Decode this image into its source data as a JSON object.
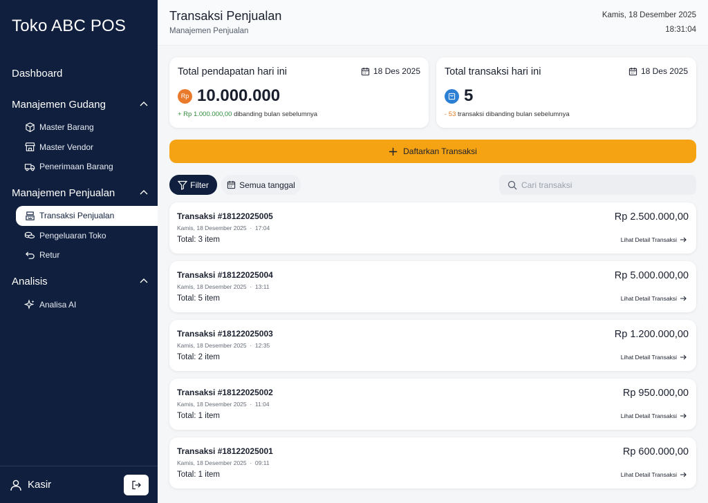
{
  "sidebar": {
    "brand": "Toko ABC POS",
    "dashboard": "Dashboard",
    "sections": [
      {
        "label": "Manajemen Gudang",
        "items": [
          {
            "label": "Master Barang",
            "icon": "box-icon"
          },
          {
            "label": "Master Vendor",
            "icon": "store-icon"
          },
          {
            "label": "Penerimaan Barang",
            "icon": "truck-icon"
          }
        ]
      },
      {
        "label": "Manajemen Penjualan",
        "items": [
          {
            "label": "Transaksi Penjualan",
            "icon": "register-icon",
            "active": true
          },
          {
            "label": "Pengeluaran Toko",
            "icon": "coins-icon"
          },
          {
            "label": "Retur",
            "icon": "undo-icon"
          }
        ]
      },
      {
        "label": "Analisis",
        "items": [
          {
            "label": "Analisa AI",
            "icon": "sparkle-icon"
          }
        ]
      }
    ],
    "user": "Kasir"
  },
  "header": {
    "title": "Transaksi Penjualan",
    "subtitle": "Manajemen Penjualan",
    "date": "Kamis, 18 Desember 2025",
    "time": "18:31:04"
  },
  "stats": {
    "revenue": {
      "title": "Total pendapatan hari ini",
      "date": "18 Des 2025",
      "badge": "Rp",
      "value": "10.000.000",
      "delta": "+ Rp 1.000.000,00",
      "compare": " dibanding bulan sebelumnya"
    },
    "transactions": {
      "title": "Total transaksi hari ini",
      "date": "18 Des 2025",
      "value": "5",
      "delta": "- 53",
      "compare": " transaksi dibanding bulan sebelumnya"
    }
  },
  "actions": {
    "register": "Daftarkan Transaksi",
    "filter": "Filter",
    "all_dates": "Semua tanggal",
    "search_placeholder": "Cari transaksi"
  },
  "transactions": [
    {
      "id": "Transaksi #18122025005",
      "date": "Kamis, 18 Desember 2025",
      "time": "17:04",
      "total": "Total: 3 item",
      "amount": "Rp 2.500.000,00"
    },
    {
      "id": "Transaksi #18122025004",
      "date": "Kamis, 18 Desember 2025",
      "time": "13:11",
      "total": "Total: 5 item",
      "amount": "Rp 5.000.000,00"
    },
    {
      "id": "Transaksi #18122025003",
      "date": "Kamis, 18 Desember 2025",
      "time": "12:35",
      "total": "Total: 2 item",
      "amount": "Rp 1.200.000,00"
    },
    {
      "id": "Transaksi #18122025002",
      "date": "Kamis, 18 Desember 2025",
      "time": "11:04",
      "total": "Total: 1 item",
      "amount": "Rp 950.000,00"
    },
    {
      "id": "Transaksi #18122025001",
      "date": "Kamis, 18 Desember 2025",
      "time": "09:11",
      "total": "Total: 1 item",
      "amount": "Rp 600.000,00"
    }
  ],
  "detail_link": "Lihat Detail Transaksi",
  "colors": {
    "sidebar": "#0f1f3d",
    "accent": "#f6a313",
    "positive": "#2e8b3a",
    "negative": "#e07b1f"
  }
}
